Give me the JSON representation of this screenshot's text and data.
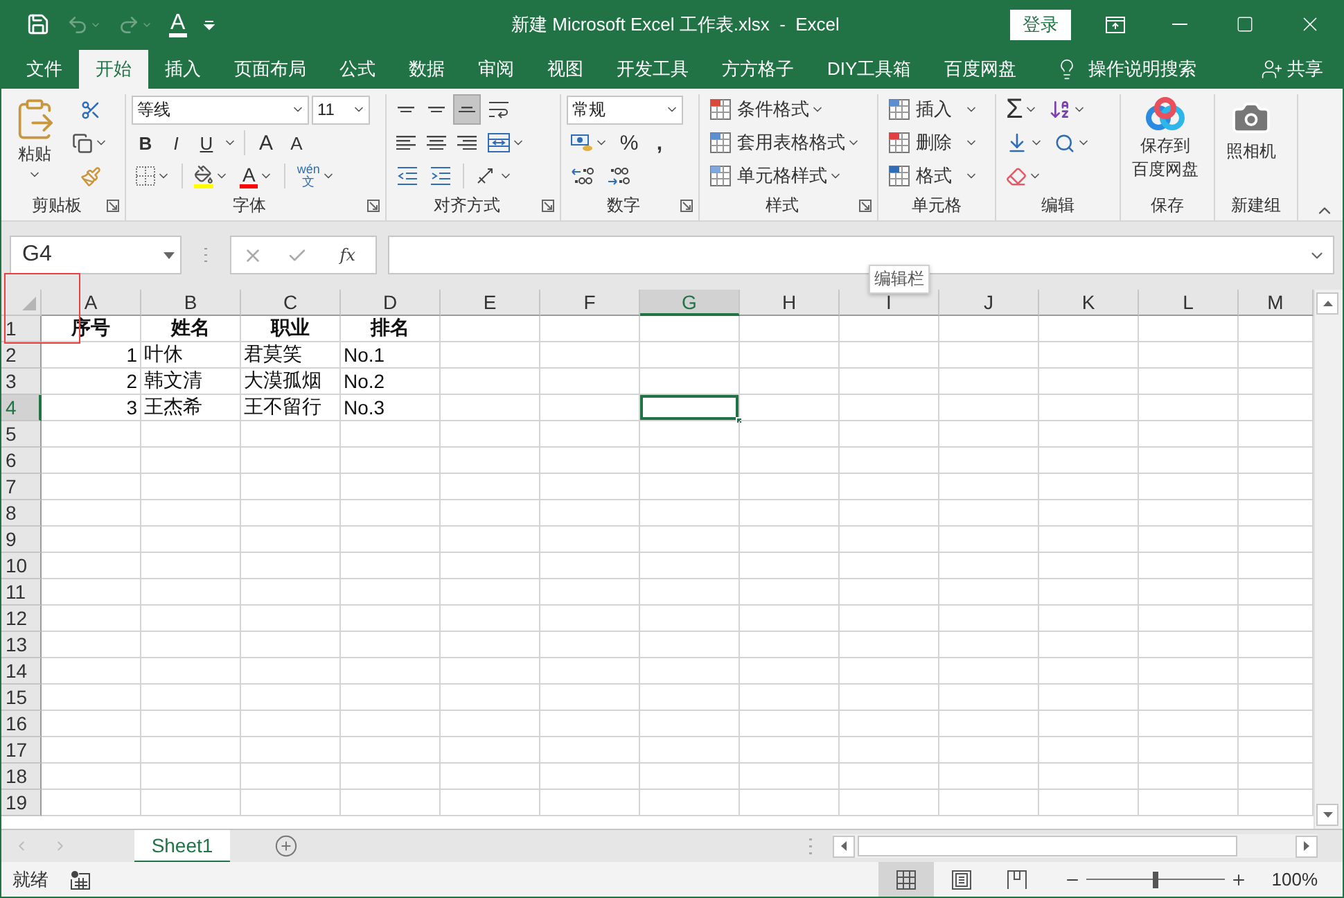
{
  "window": {
    "title": "新建 Microsoft Excel 工作表.xlsx  -  Excel",
    "login": "登录"
  },
  "quick_access": {
    "font_color": "A"
  },
  "tabs": [
    {
      "label": "文件",
      "selected": false
    },
    {
      "label": "开始",
      "selected": true
    },
    {
      "label": "插入",
      "selected": false
    },
    {
      "label": "页面布局",
      "selected": false
    },
    {
      "label": "公式",
      "selected": false
    },
    {
      "label": "数据",
      "selected": false
    },
    {
      "label": "审阅",
      "selected": false
    },
    {
      "label": "视图",
      "selected": false
    },
    {
      "label": "开发工具",
      "selected": false
    },
    {
      "label": "方方格子",
      "selected": false
    },
    {
      "label": "DIY工具箱",
      "selected": false
    },
    {
      "label": "百度网盘",
      "selected": false
    }
  ],
  "tell_me": "操作说明搜索",
  "share": "共享",
  "ribbon": {
    "clipboard": {
      "label": "剪贴板",
      "paste": "粘贴"
    },
    "font": {
      "label": "字体",
      "font_name": "等线",
      "font_size": "11",
      "style_buttons": [
        "B",
        "I",
        "U"
      ],
      "size_buttons": [
        "A",
        "A"
      ],
      "font_color": "A",
      "phonetic_top": "wén",
      "phonetic_bottom": "文"
    },
    "alignment": {
      "label": "对齐方式",
      "vertical_align": [
        {
          "selected": false
        },
        {
          "selected": false
        },
        {
          "selected": true
        }
      ]
    },
    "number": {
      "label": "数字",
      "format": "常规",
      "percent": "%",
      "comma": ","
    },
    "styles": {
      "label": "样式",
      "items": [
        "条件格式",
        "套用表格格式",
        "单元格样式"
      ]
    },
    "cells": {
      "label": "单元格",
      "items": [
        "插入",
        "删除",
        "格式"
      ]
    },
    "editing": {
      "label": "编辑",
      "sum": "Σ"
    },
    "save": {
      "label": "保存",
      "button": [
        "保存到",
        "百度网盘"
      ]
    },
    "new_group": {
      "label": "新建组",
      "button": "照相机"
    }
  },
  "formula_bar": {
    "name_box": "G4",
    "fx": "fx",
    "tooltip": "编辑栏"
  },
  "sheet": {
    "columns": [
      {
        "label": "A",
        "selected": false
      },
      {
        "label": "B",
        "selected": false
      },
      {
        "label": "C",
        "selected": false
      },
      {
        "label": "D",
        "selected": false
      },
      {
        "label": "E",
        "selected": false
      },
      {
        "label": "F",
        "selected": false
      },
      {
        "label": "G",
        "selected": true
      },
      {
        "label": "H",
        "selected": false
      },
      {
        "label": "I",
        "selected": false
      },
      {
        "label": "J",
        "selected": false
      },
      {
        "label": "K",
        "selected": false
      },
      {
        "label": "L",
        "selected": false
      },
      {
        "label": "M",
        "selected": false
      }
    ],
    "rows": [
      {
        "label": "1",
        "selected": false,
        "cells": [
          {
            "text": "序号",
            "kind": "heading"
          },
          {
            "text": "姓名",
            "kind": "heading"
          },
          {
            "text": "职业",
            "kind": "heading"
          },
          {
            "text": "排名",
            "kind": "heading"
          }
        ]
      },
      {
        "label": "2",
        "selected": false,
        "cells": [
          {
            "text": "1",
            "kind": "number"
          },
          {
            "text": "叶休",
            "kind": "text"
          },
          {
            "text": "君莫笑",
            "kind": "text"
          },
          {
            "text": "No.1",
            "kind": "text"
          }
        ]
      },
      {
        "label": "3",
        "selected": false,
        "cells": [
          {
            "text": "2",
            "kind": "number"
          },
          {
            "text": "韩文清",
            "kind": "text"
          },
          {
            "text": "大漠孤烟",
            "kind": "text"
          },
          {
            "text": "No.2",
            "kind": "text"
          }
        ]
      },
      {
        "label": "4",
        "selected": true,
        "cells": [
          {
            "text": "3",
            "kind": "number"
          },
          {
            "text": "王杰希",
            "kind": "text"
          },
          {
            "text": "王不留行",
            "kind": "text"
          },
          {
            "text": "No.3",
            "kind": "text"
          }
        ]
      },
      {
        "label": "5",
        "selected": false,
        "cells": []
      },
      {
        "label": "6",
        "selected": false,
        "cells": []
      },
      {
        "label": "7",
        "selected": false,
        "cells": []
      },
      {
        "label": "8",
        "selected": false,
        "cells": []
      },
      {
        "label": "9",
        "selected": false,
        "cells": []
      },
      {
        "label": "10",
        "selected": false,
        "cells": []
      },
      {
        "label": "11",
        "selected": false,
        "cells": []
      },
      {
        "label": "12",
        "selected": false,
        "cells": []
      },
      {
        "label": "13",
        "selected": false,
        "cells": []
      },
      {
        "label": "14",
        "selected": false,
        "cells": []
      },
      {
        "label": "15",
        "selected": false,
        "cells": []
      },
      {
        "label": "16",
        "selected": false,
        "cells": []
      },
      {
        "label": "17",
        "selected": false,
        "cells": []
      },
      {
        "label": "18",
        "selected": false,
        "cells": []
      },
      {
        "label": "19",
        "selected": false,
        "cells": []
      }
    ]
  },
  "sheet_tabs": [
    {
      "label": "Sheet1",
      "selected": true
    }
  ],
  "status_bar": {
    "status": "就绪",
    "views": [
      {
        "kind": "normal",
        "selected": true
      },
      {
        "kind": "page_layout",
        "selected": false
      },
      {
        "kind": "page_break",
        "selected": false
      }
    ],
    "zoom": {
      "level": 0.5,
      "reading": "100%"
    }
  }
}
